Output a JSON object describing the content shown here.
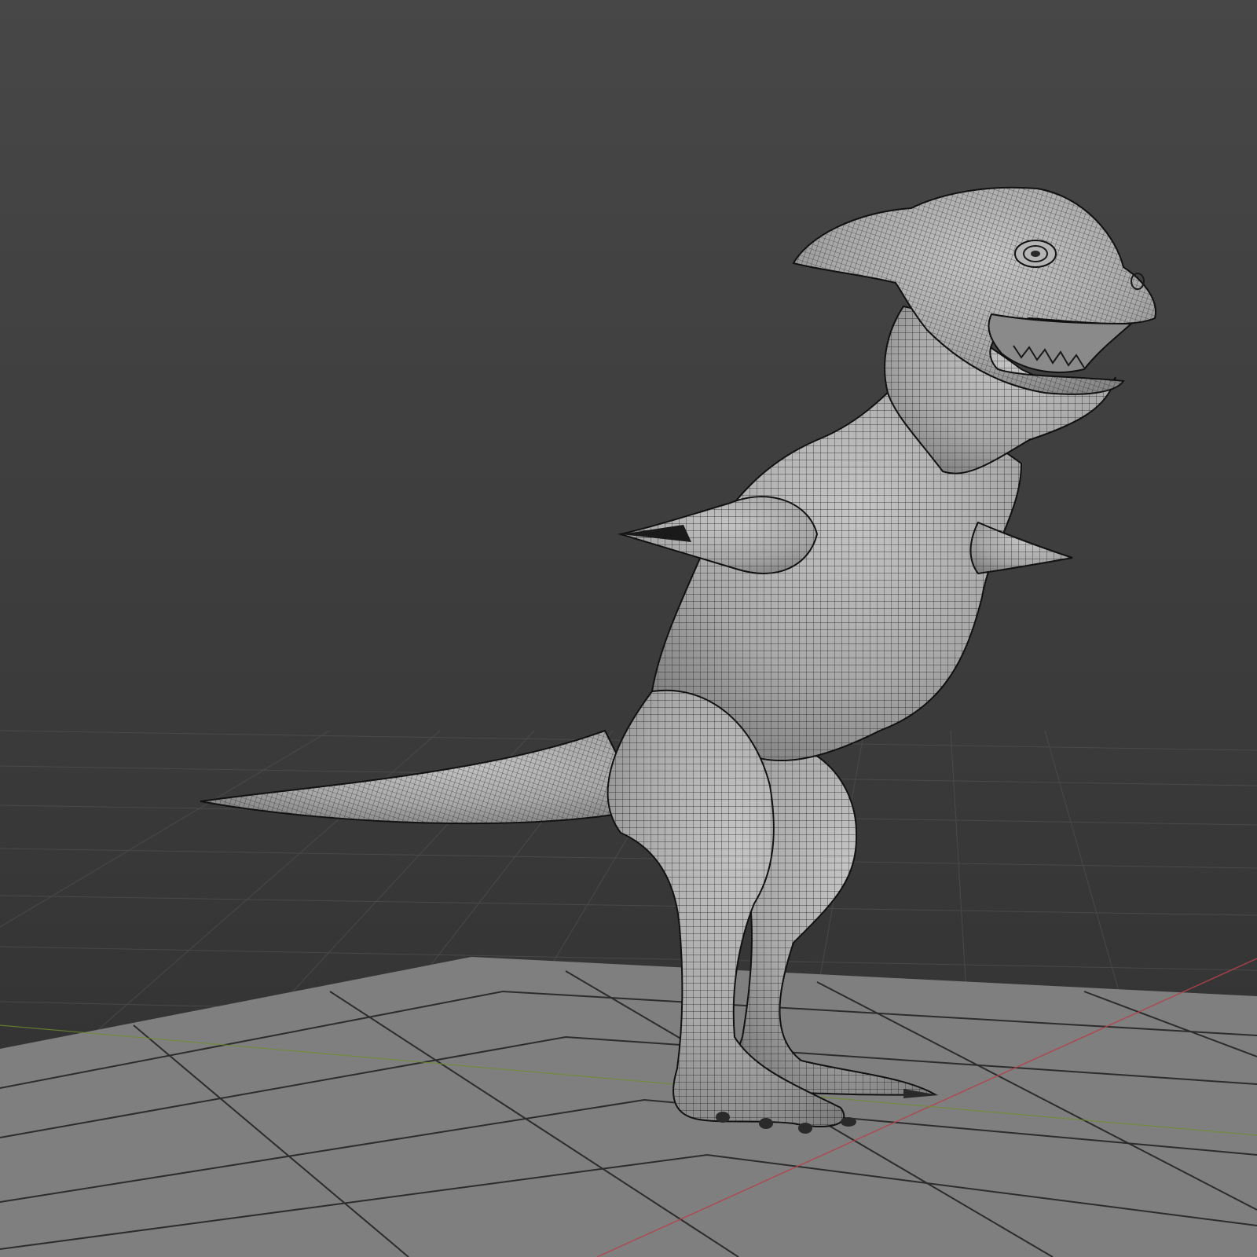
{
  "viewport": {
    "background_top": "#444444",
    "background_bottom": "#2e2e2e",
    "grid_line_color": "#525252",
    "ground_plane_color": "#808080",
    "ground_plane_line_color": "#2a2a2a",
    "x_axis_color": "#b3424a",
    "y_axis_color": "#6e8f2e",
    "model_fill": "#a9a9a9",
    "wireframe_color": "#1e1e1e",
    "model": "creature-mesh",
    "shading": "solid-with-wireframe-overlay"
  }
}
